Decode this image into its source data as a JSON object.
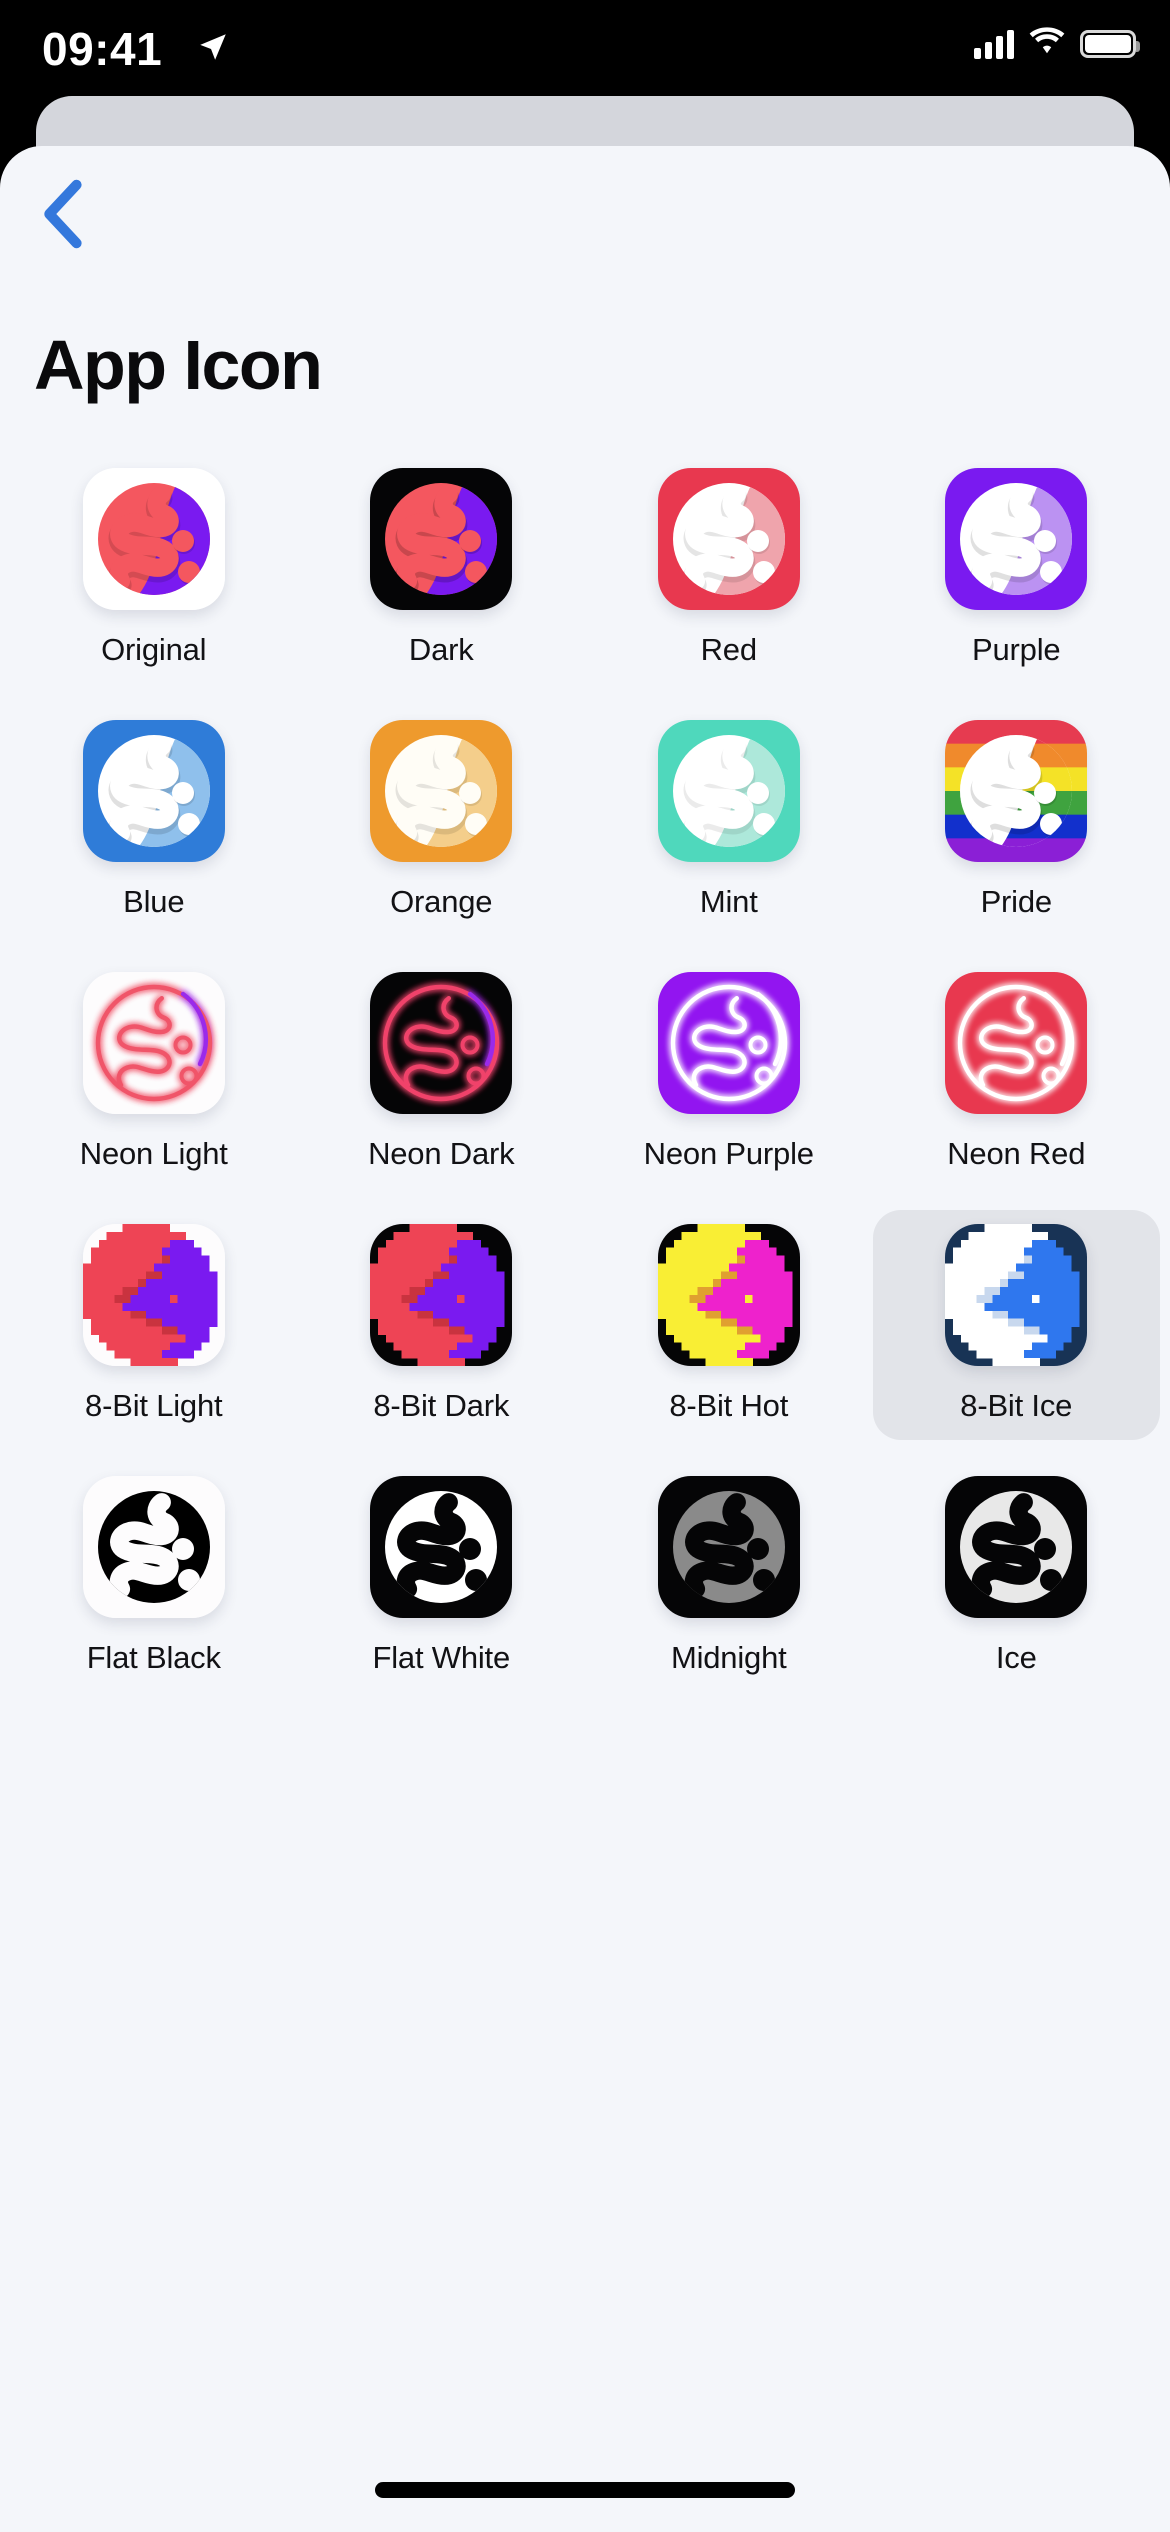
{
  "status_bar": {
    "time": "09:41",
    "location_icon": "location-arrow-icon",
    "signal_icon": "cellular-signal-icon",
    "wifi_icon": "wifi-icon",
    "battery_icon": "battery-full-icon"
  },
  "nav": {
    "back_icon": "chevron-left-icon",
    "back_color": "#3478DC"
  },
  "header": {
    "title": "App Icon"
  },
  "theme": {
    "page_background": "#f4f6fa",
    "selected_background": "#e2e4e9",
    "label_color": "#121215",
    "accent": "#3478DC"
  },
  "icons": [
    {
      "label": "Original",
      "style": "gloss",
      "selected": false,
      "bg": "#ffffff",
      "left": "#F4575F",
      "right": "#7A1AF0",
      "dot": "#F4575F",
      "shade": "rgba(0,0,0,0.13)"
    },
    {
      "label": "Dark",
      "style": "gloss",
      "selected": false,
      "bg": "#050506",
      "left": "#F4575F",
      "right": "#7A1AF0",
      "dot": "#F4575F",
      "shade": "rgba(0,0,0,0.18)"
    },
    {
      "label": "Red",
      "style": "gloss",
      "selected": false,
      "bg": "#E8384F",
      "left": "#ffffff",
      "right": "#EFA4AC",
      "dot": "#ffffff",
      "shade": "rgba(0,0,0,0.10)"
    },
    {
      "label": "Purple",
      "style": "gloss",
      "selected": false,
      "bg": "#7A1AF0",
      "left": "#ffffff",
      "right": "#BB92F2",
      "dot": "#ffffff",
      "shade": "rgba(0,0,0,0.12)"
    },
    {
      "label": "Blue",
      "style": "gloss",
      "selected": false,
      "bg": "#2F7CD8",
      "left": "#ffffff",
      "right": "#8FC0EC",
      "dot": "#ffffff",
      "shade": "rgba(0,0,0,0.12)"
    },
    {
      "label": "Orange",
      "style": "gloss",
      "selected": false,
      "bg": "#EE9A2D",
      "left": "#FFFDF6",
      "right": "#F4CE8B",
      "dot": "#FFFDF6",
      "shade": "rgba(0,0,0,0.10)"
    },
    {
      "label": "Mint",
      "style": "gloss",
      "selected": false,
      "bg": "#4FD8BC",
      "left": "#ffffff",
      "right": "#ADE8DA",
      "dot": "#ffffff",
      "shade": "rgba(0,0,0,0.08)"
    },
    {
      "label": "Pride",
      "style": "pride",
      "selected": false,
      "bg": "#E8384F",
      "left": "#ffffff",
      "right": "rgba(0,0,0,0.22)",
      "dot": "#ffffff",
      "shade": "rgba(0,0,0,0.12)",
      "stripes": [
        "#E63B50",
        "#F08A2C",
        "#F4E227",
        "#3FA33F",
        "#1230CC",
        "#8B1FD6"
      ]
    },
    {
      "label": "Neon Light",
      "style": "neon",
      "selected": false,
      "bg": "#FDFCFD",
      "stroke": "#F05469",
      "stroke2": "#9A2BEA",
      "glow": "rgba(240,84,105,0.55)"
    },
    {
      "label": "Neon Dark",
      "style": "neon",
      "selected": false,
      "bg": "#050506",
      "stroke": "#F0436A",
      "stroke2": "#9A2BEA",
      "glow": "rgba(240,67,106,0.85)"
    },
    {
      "label": "Neon Purple",
      "style": "neon",
      "selected": false,
      "bg": "#9215F0",
      "stroke": "#ffffff",
      "stroke2": "#ffffff",
      "glow": "rgba(255,255,255,0.8)"
    },
    {
      "label": "Neon Red",
      "style": "neon",
      "selected": false,
      "bg": "#E8384F",
      "stroke": "#ffffff",
      "stroke2": "#ffffff",
      "glow": "rgba(255,255,255,0.8)"
    },
    {
      "label": "8-Bit Light",
      "style": "pixel",
      "selected": false,
      "bg": "#FDFCFD",
      "left": "#EE4455",
      "right": "#7A1AF0",
      "dot": "#EE4455",
      "shade": "#C9333F"
    },
    {
      "label": "8-Bit Dark",
      "style": "pixel",
      "selected": false,
      "bg": "#050506",
      "left": "#EE4455",
      "right": "#7A1AF0",
      "dot": "#EE4455",
      "shade": "#C9333F"
    },
    {
      "label": "8-Bit Hot",
      "style": "pixel",
      "selected": false,
      "bg": "#050506",
      "left": "#F9EE34",
      "right": "#EE22CC",
      "dot": "#F9EE34",
      "shade": "#E0A030"
    },
    {
      "label": "8-Bit Ice",
      "style": "pixel",
      "selected": true,
      "bg": "#183355",
      "left": "#FFFFFF",
      "right": "#2F77EE",
      "dot": "#FFFFFF",
      "shade": "#C8D8EE"
    },
    {
      "label": "Flat Black",
      "style": "flat",
      "selected": false,
      "bg": "#FDFCFD",
      "left": "#000000",
      "right": "#000000",
      "dot": "#FDFCFD",
      "shade": "rgba(255,255,255,0.0)"
    },
    {
      "label": "Flat White",
      "style": "flat",
      "selected": false,
      "bg": "#050506",
      "left": "#ffffff",
      "right": "#ffffff",
      "dot": "#050506",
      "shade": "rgba(0,0,0,0.0)"
    },
    {
      "label": "Midnight",
      "style": "flat",
      "selected": false,
      "bg": "#050506",
      "left": "#8A8A8A",
      "right": "#8A8A8A",
      "dot": "#3A3A3A",
      "shade": "rgba(0,0,0,0.0)"
    },
    {
      "label": "Ice",
      "style": "flat",
      "selected": false,
      "bg": "#050506",
      "left": "#E8E8E8",
      "right": "#E8E8E8",
      "dot": "#050506",
      "shade": "rgba(0,0,0,0.0)"
    }
  ]
}
